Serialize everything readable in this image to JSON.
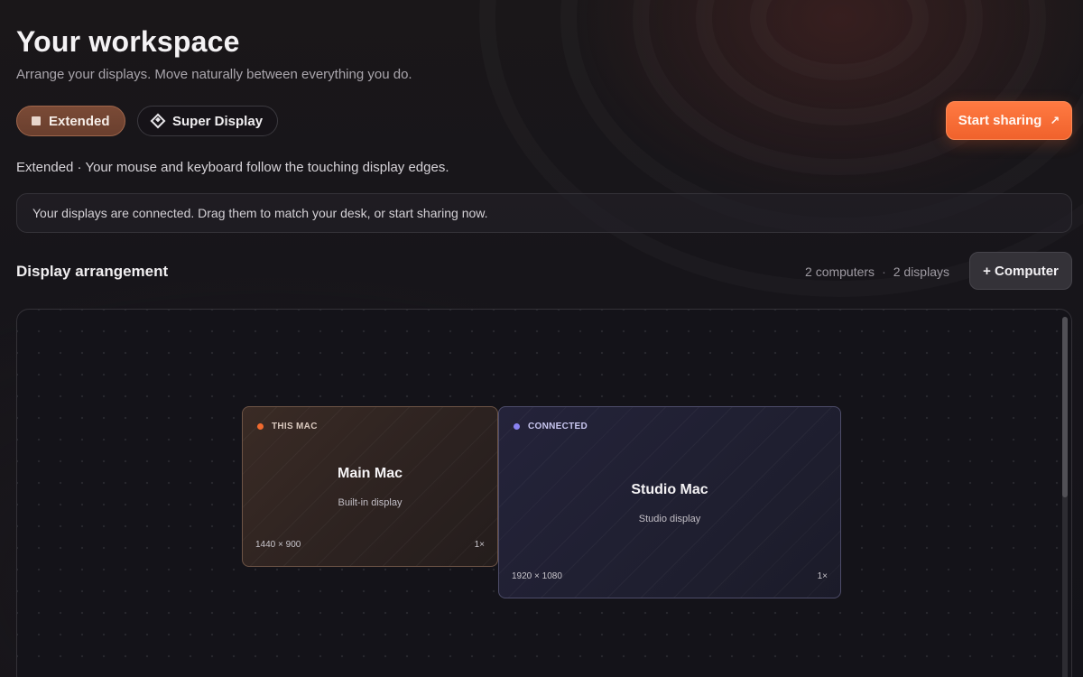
{
  "header": {
    "title": "Your workspace",
    "subtitle": "Arrange your displays. Move naturally between everything you do."
  },
  "modes": [
    {
      "label": "Extended",
      "icon": "square-icon",
      "active": true
    },
    {
      "label": "Super Display",
      "icon": "diamond-icon",
      "active": false
    }
  ],
  "share_button": {
    "label": "Start sharing",
    "icon": "arrow-up-right-icon"
  },
  "mode_description": "Extended · Your mouse and keyboard follow the touching display edges.",
  "banner": "Your displays are connected. Drag them to match your desk, or start sharing now.",
  "arrangement": {
    "title": "Display arrangement",
    "computers_count": "2 computers",
    "displays_count": "2 displays",
    "separator": "·",
    "add_button": "+ Computer"
  },
  "displays": [
    {
      "status": "THIS MAC",
      "name": "Main Mac",
      "kind": "Built-in display",
      "resolution": "1440 × 900",
      "scale": "1×"
    },
    {
      "status": "CONNECTED",
      "name": "Studio Mac",
      "kind": "Studio display",
      "resolution": "1920 × 1080",
      "scale": "1×"
    }
  ],
  "colors": {
    "accent": "#f06a2e",
    "connected": "#8a82f2",
    "active_mode": "#7a4a36"
  }
}
